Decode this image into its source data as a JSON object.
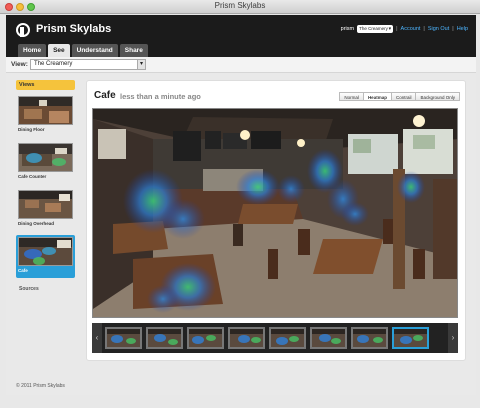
{
  "window": {
    "title": "Prism Skylabs"
  },
  "header": {
    "logo_text": "Prism Skylabs",
    "brand": "prism",
    "site_select_value": "The Creamery",
    "links": [
      "Account",
      "Sign Out",
      "Help"
    ],
    "tabs": [
      "Home",
      "See",
      "Understand",
      "Share"
    ],
    "active_tab": "See"
  },
  "viewbar": {
    "label": "View:",
    "selected": "The Creamery"
  },
  "sidebar": {
    "title": "Views",
    "items": [
      {
        "label": "Dining Floor",
        "active": false
      },
      {
        "label": "Cafe Counter",
        "active": false
      },
      {
        "label": "Dining Overhead",
        "active": false
      },
      {
        "label": "Cafe",
        "active": true
      }
    ],
    "sources_label": "Sources"
  },
  "camera": {
    "title": "Cafe",
    "updated": "less than a minute ago",
    "modes": [
      "Normal",
      "Heatmap",
      "Contrail",
      "Background Only"
    ],
    "active_mode": "Heatmap"
  },
  "filmstrip": {
    "left_arrow": "‹",
    "right_arrow": "›",
    "thumb_count": 8,
    "active_index": 7
  },
  "footer": {
    "copyright": "© 2011 Prism Skylabs"
  },
  "colors": {
    "accent_blue": "#2a9fd8",
    "views_header": "#f5c33c",
    "header_bg": "#1b1b1b"
  }
}
